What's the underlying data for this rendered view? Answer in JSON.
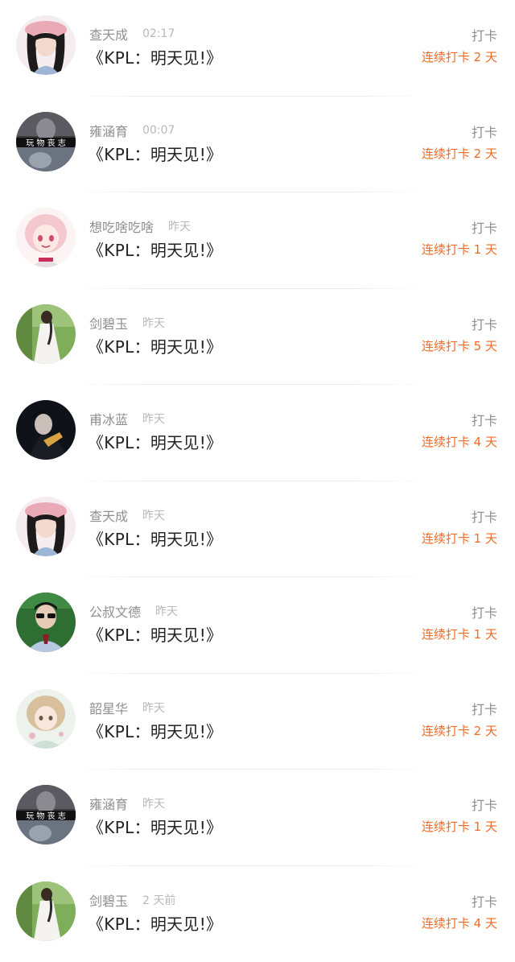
{
  "items": [
    {
      "name": "查天成",
      "time": "02:17",
      "title": "《KPL：明天见!》",
      "action": "打卡",
      "streak": "连续打卡 2 天",
      "avatar": "girl-pink-beret"
    },
    {
      "name": "雍涵育",
      "time": "00:07",
      "title": "《KPL：明天见!》",
      "action": "打卡",
      "streak": "连续打卡 2 天",
      "avatar": "wanwu-sangzhi",
      "avatar_text": "玩 物 丧 志"
    },
    {
      "name": "想吃啥吃啥",
      "time": "昨天",
      "title": "《KPL：明天见!》",
      "action": "打卡",
      "streak": "连续打卡 1 天",
      "avatar": "anime-pink-hair"
    },
    {
      "name": "剑碧玉",
      "time": "昨天",
      "title": "《KPL：明天见!》",
      "action": "打卡",
      "streak": "连续打卡 5 天",
      "avatar": "bride-garden"
    },
    {
      "name": "甫冰蓝",
      "time": "昨天",
      "title": "《KPL：明天见!》",
      "action": "打卡",
      "streak": "连续打卡 4 天",
      "avatar": "dark-portrait"
    },
    {
      "name": "查天成",
      "time": "昨天",
      "title": "《KPL：明天见!》",
      "action": "打卡",
      "streak": "连续打卡 1 天",
      "avatar": "girl-pink-beret"
    },
    {
      "name": "公叔文德",
      "time": "昨天",
      "title": "《KPL：明天见!》",
      "action": "打卡",
      "streak": "连续打卡 1 天",
      "avatar": "boy-sunglasses"
    },
    {
      "name": "韶星华",
      "time": "昨天",
      "title": "《KPL：明天见!》",
      "action": "打卡",
      "streak": "连续打卡 2 天",
      "avatar": "anime-pastel-girl"
    },
    {
      "name": "雍涵育",
      "time": "昨天",
      "title": "《KPL：明天见!》",
      "action": "打卡",
      "streak": "连续打卡 1 天",
      "avatar": "wanwu-sangzhi",
      "avatar_text": "玩 物 丧 志"
    },
    {
      "name": "剑碧玉",
      "time": "2 天前",
      "title": "《KPL：明天见!》",
      "action": "打卡",
      "streak": "连续打卡 4 天",
      "avatar": "bride-garden"
    }
  ],
  "colors": {
    "name": "#8f8f8f",
    "time": "#b8b8b8",
    "title": "#222222",
    "streak": "#f06b25",
    "divider": "#ececec"
  }
}
